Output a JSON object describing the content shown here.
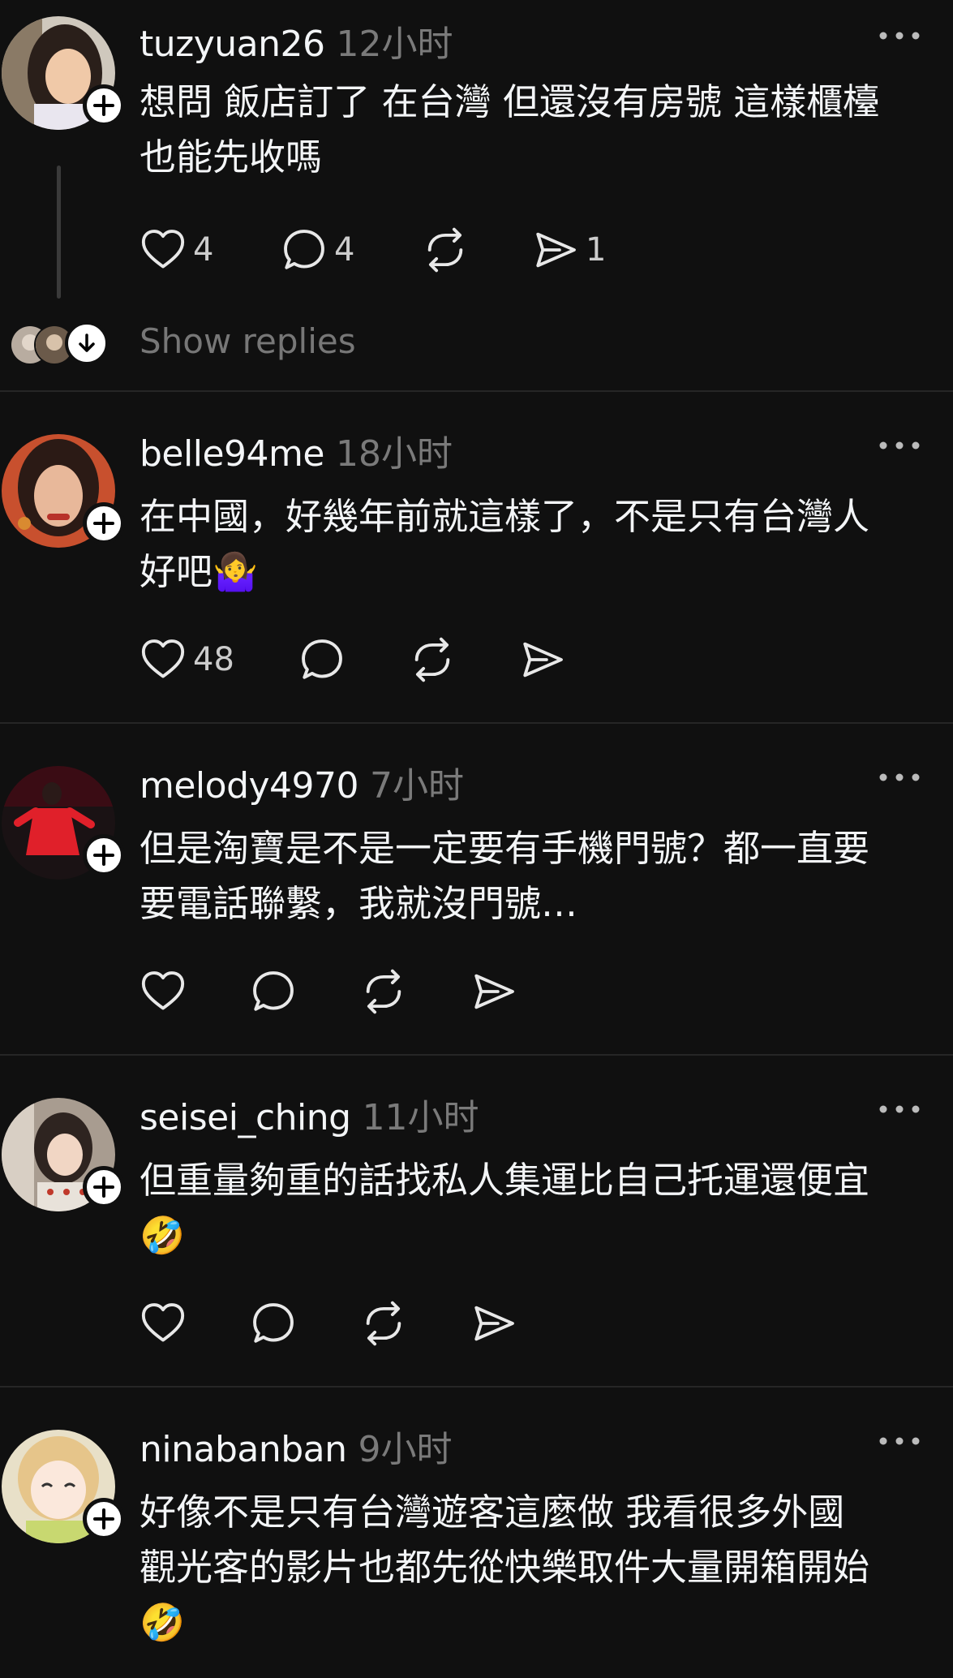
{
  "posts": [
    {
      "username": "tuzyuan26",
      "time": "12小时",
      "lines": [
        "想問 飯店訂了 在台灣 但還沒有房號 這樣櫃檯",
        "也能先收嗎"
      ],
      "likes": "4",
      "comments": "4",
      "reposts": "",
      "shares": "1",
      "show_replies": "Show replies"
    },
    {
      "username": "belle94me",
      "time": "18小时",
      "lines": [
        "在中國，好幾年前就這樣了，不是只有台灣人",
        "好吧🤷‍♀️"
      ],
      "likes": "48",
      "comments": "",
      "reposts": "",
      "shares": ""
    },
    {
      "username": "melody4970",
      "time": "7小时",
      "lines": [
        "但是淘寶是不是一定要有手機門號？都一直要",
        "要電話聯繫，我就沒門號…"
      ],
      "likes": "",
      "comments": "",
      "reposts": "",
      "shares": ""
    },
    {
      "username": "seisei_ching",
      "time": "11小时",
      "lines": [
        "但重量夠重的話找私人集運比自己托運還便宜",
        "🤣"
      ],
      "likes": "",
      "comments": "",
      "reposts": "",
      "shares": ""
    },
    {
      "username": "ninabanban",
      "time": "9小时",
      "lines": [
        "好像不是只有台灣遊客這麼做 我看很多外國",
        "觀光客的影片也都先從快樂取件大量開箱開始",
        "🤣"
      ],
      "likes": "",
      "comments": "",
      "reposts": "",
      "shares": ""
    }
  ],
  "colors": {
    "background": "#101010",
    "text": "#f3f5f7",
    "muted": "#7a7a7a",
    "separator": "#262626"
  },
  "icons": [
    "heart-icon",
    "comment-icon",
    "repost-icon",
    "share-icon",
    "more-icon",
    "follow-plus-icon",
    "chevron-down-icon"
  ]
}
